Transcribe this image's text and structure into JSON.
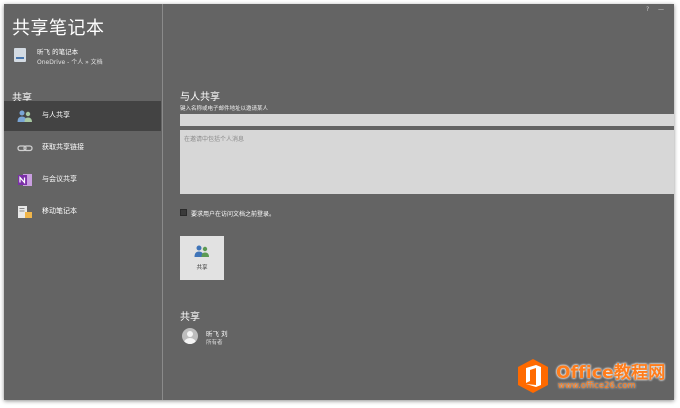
{
  "app": {
    "title": "共享笔记本"
  },
  "notebook": {
    "name": "昕飞 的笔记本",
    "path": "OneDrive - 个人 » 文档"
  },
  "sidebar": {
    "section": "共享",
    "items": [
      {
        "label": "与人共享",
        "icon": "people-icon"
      },
      {
        "label": "获取共享链接",
        "icon": "link-icon"
      },
      {
        "label": "与会议共享",
        "icon": "onenote-icon"
      },
      {
        "label": "移动笔记本",
        "icon": "move-notebook-icon"
      }
    ]
  },
  "share_panel": {
    "title": "与人共享",
    "hint": "键入名称或电子邮件地址以邀请某人",
    "email_value": "",
    "message_placeholder": "在邀请中包括个人消息",
    "require_signin_label": "要求用户在访问文档之前登录。",
    "share_button_label": "共享"
  },
  "shared_with": {
    "heading": "共享",
    "users": [
      {
        "name": "昕飞 刘",
        "role": "所有者"
      }
    ]
  },
  "window_controls": [
    "?",
    "—"
  ],
  "watermark": {
    "main": "Office教程网",
    "sub": "www.office26.com"
  },
  "colors": {
    "accent": "#ff7d1c",
    "panel": "#646464",
    "active": "#434343"
  }
}
